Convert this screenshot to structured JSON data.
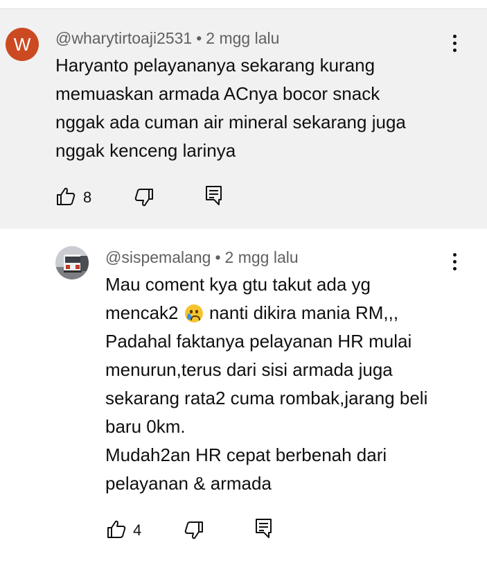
{
  "comments": [
    {
      "avatar_letter": "W",
      "handle": "@wharytirtoaji2531",
      "separator": "•",
      "time": "2 mgg lalu",
      "lines": [
        "Haryanto pelayananya sekarang kurang",
        "memuaskan armada ACnya bocor snack",
        "nggak ada cuman air mineral sekarang juga",
        "nggak kenceng larinya"
      ],
      "likes": "8"
    },
    {
      "handle": "@sispemalang",
      "separator": "•",
      "time": "2 mgg lalu",
      "line1": "Mau coment kya gtu takut ada yg",
      "line2_before": "mencak2",
      "line2_after": "nanti dikira mania RM,,,",
      "lines_rest": [
        "Padahal faktanya pelayanan HR mulai",
        "menurun,terus dari sisi armada juga",
        "sekarang rata2 cuma rombak,jarang beli",
        "baru 0km.",
        "Mudah2an HR cepat berbenah dari",
        "pelayanan & armada"
      ],
      "likes": "4"
    }
  ],
  "icons": {
    "like": "thumb-up-icon",
    "dislike": "thumb-down-icon",
    "reply": "reply-icon",
    "menu": "more-vert-icon",
    "emoji": "crying-face-emoji"
  },
  "colors": {
    "highlight_bg": "#f1f1f1",
    "avatar_bg": "#cc4a22",
    "meta_text": "#606060"
  }
}
